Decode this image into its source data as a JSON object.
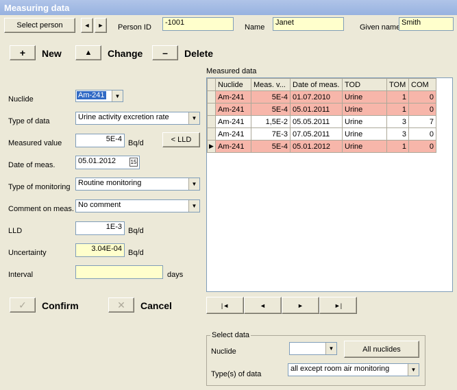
{
  "window": {
    "title": "Measuring data"
  },
  "person": {
    "select_label": "Select person",
    "prev_icon": "triangle-left-icon",
    "next_icon": "triangle-right-icon",
    "id_label": "Person ID",
    "id_value": "-1001",
    "name_label": "Name",
    "name_value": "Janet",
    "given_label": "Given name",
    "given_value": "Smith"
  },
  "toolbar": {
    "new_label": "New",
    "change_label": "Change",
    "delete_label": "Delete",
    "new_icon": "+",
    "change_icon": "▲",
    "delete_icon": "–"
  },
  "form": {
    "nuclide_label": "Nuclide",
    "nuclide_value": "Am-241",
    "type_label": "Type of data",
    "type_value": "Urine activity excretion rate",
    "measured_label": "Measured value",
    "measured_value": "5E-4",
    "measured_unit": "Bq/d",
    "lld_button": "< LLD",
    "date_label": "Date of meas.",
    "date_value": "05.01.2012",
    "monitoring_label": "Type of monitoring",
    "monitoring_value": "Routine monitoring",
    "comment_label": "Comment on meas.",
    "comment_value": "No comment",
    "lld_label": "LLD",
    "lld_value": "1E-3",
    "lld_unit": "Bq/d",
    "uncertainty_label": "Uncertainty",
    "uncertainty_value": "3.04E-04",
    "uncertainty_unit": "Bq/d",
    "interval_label": "Interval",
    "interval_value": "",
    "interval_unit": "days"
  },
  "actions": {
    "confirm_label": "Confirm",
    "cancel_label": "Cancel"
  },
  "grid": {
    "title": "Measured data",
    "columns": [
      "Nuclide",
      "Meas. v...",
      "Date of meas.",
      "TOD",
      "TOM",
      "COM"
    ],
    "rows": [
      [
        "Am-241",
        "5E-4",
        "01.07.2010",
        "Urine",
        "1",
        "0"
      ],
      [
        "Am-241",
        "5E-4",
        "05.01.2011",
        "Urine",
        "1",
        "0"
      ],
      [
        "Am-241",
        "1,5E-2",
        "05.05.2011",
        "Urine",
        "3",
        "7"
      ],
      [
        "Am-241",
        "7E-3",
        "07.05.2011",
        "Urine",
        "3",
        "0"
      ],
      [
        "Am-241",
        "5E-4",
        "05.01.2012",
        "Urine",
        "1",
        "0"
      ]
    ],
    "highlighted_rows": [
      0,
      1,
      4
    ],
    "current_row": 4,
    "highlight_color": "#f7b6aa"
  },
  "nav": {
    "first": "|◄",
    "prev": "◄",
    "next": "►",
    "last": "►|"
  },
  "select_data": {
    "legend": "Select data",
    "nuclide_label": "Nuclide",
    "nuclide_value": "",
    "all_nuclides": "All nuclides",
    "types_label": "Type(s) of data",
    "types_value": "all except room air monitoring"
  }
}
